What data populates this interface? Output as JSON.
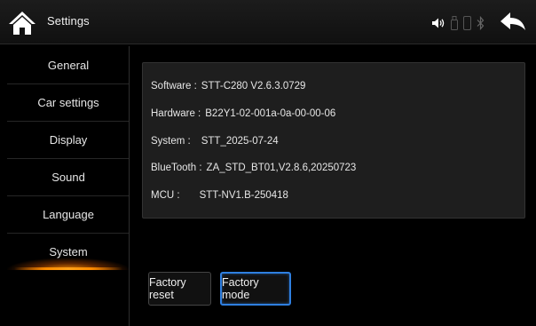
{
  "header": {
    "title": "Settings",
    "icons": [
      "home-icon",
      "speaker-icon",
      "usb-icon",
      "phone-icon",
      "bluetooth-icon",
      "back-icon"
    ]
  },
  "sidebar": {
    "items": [
      {
        "label": "General"
      },
      {
        "label": "Car settings"
      },
      {
        "label": "Display"
      },
      {
        "label": "Sound"
      },
      {
        "label": "Language"
      },
      {
        "label": "System",
        "active": true
      }
    ]
  },
  "info": {
    "rows": [
      {
        "label": "Software :",
        "value": "STT-C280 V2.6.3.0729"
      },
      {
        "label": "Hardware :",
        "value": "B22Y1-02-001a-0a-00-00-06"
      },
      {
        "label": "System :",
        "value": "STT_2025-07-24"
      },
      {
        "label": "BlueTooth :",
        "value": "ZA_STD_BT01,V2.8.6,20250723"
      },
      {
        "label": "MCU :",
        "value": "STT-NV1.B-250418"
      }
    ]
  },
  "buttons": {
    "factory_reset": "Factory reset",
    "factory_mode": "Factory mode"
  },
  "colors": {
    "accent_orange": "#ff8c00",
    "focus_blue": "#2f7fe0",
    "panel_bg": "#1e1e1e"
  }
}
